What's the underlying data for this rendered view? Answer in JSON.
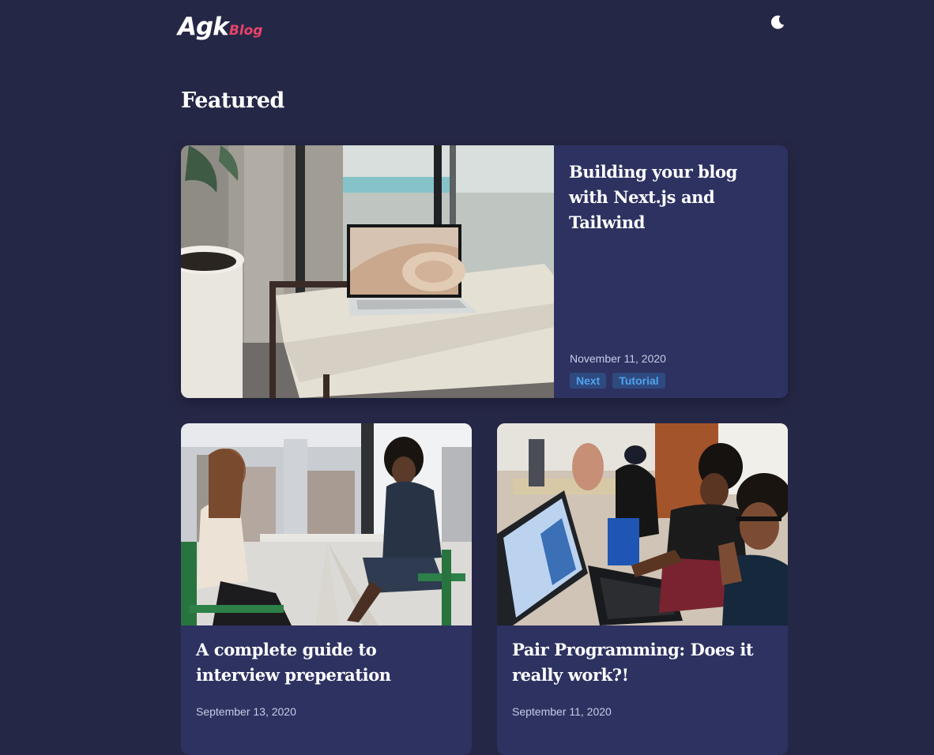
{
  "header": {
    "logo_main": "Agk",
    "logo_sub": "Blog",
    "theme_toggle_icon": "moon-icon"
  },
  "featured_section": {
    "title": "Featured"
  },
  "featured_post": {
    "title": "Building your blog with Next.js and Tailwind",
    "date": "November 11, 2020",
    "tags": [
      "Next",
      "Tutorial"
    ],
    "image": "laptop-on-bench-photo"
  },
  "posts": [
    {
      "title": "A complete guide to interview preperation",
      "date": "September 13, 2020",
      "image": "two-women-interview-photo"
    },
    {
      "title": "Pair Programming: Does it really work?!",
      "date": "September 11, 2020",
      "image": "developers-pair-programming-photo"
    }
  ],
  "colors": {
    "background": "#252746",
    "card": "#2d3261",
    "accent": "#e8436a",
    "tag_bg": "#2f4a7f",
    "tag_text": "#4fa3ee"
  }
}
